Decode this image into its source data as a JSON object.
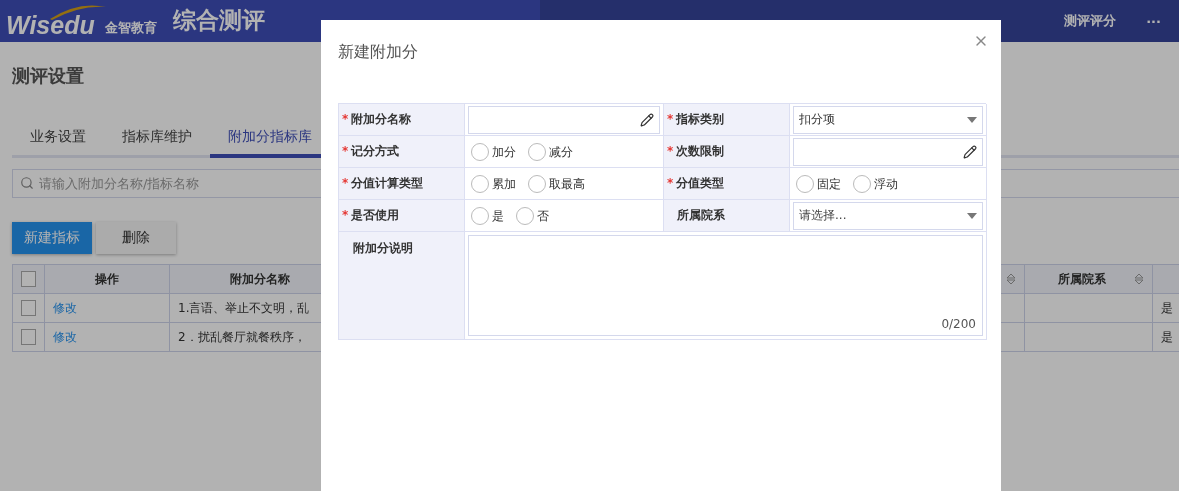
{
  "header": {
    "logo_text": "Wisedu",
    "logo_subtitle": "金智教育",
    "app_title": "综合测评",
    "nav": [
      {
        "label": "测评评分"
      }
    ],
    "more": "···"
  },
  "page": {
    "title": "测评设置",
    "tabs": [
      {
        "label": "业务设置",
        "selected": false
      },
      {
        "label": "指标库维护",
        "selected": false
      },
      {
        "label": "附加分指标库",
        "selected": true
      }
    ],
    "search": {
      "placeholder": "请输入附加分名称/指标名称"
    },
    "buttons": [
      {
        "label": "新建指标",
        "kind": "primary"
      },
      {
        "label": "删除",
        "kind": "default"
      }
    ],
    "table": {
      "columns": [
        {
          "label": "操作",
          "sortable": false
        },
        {
          "label": "附加分名称",
          "sortable": false
        },
        {
          "sortable": true
        },
        {
          "label": "所属院系",
          "sortable": true
        },
        {
          "sortable": false
        }
      ],
      "header_checked": false,
      "rows": [
        {
          "checked": false,
          "action": "修改",
          "name": "1.言语、举止不文明，乱",
          "column_5": "是"
        },
        {
          "checked": false,
          "action": "修改",
          "name": "2．扰乱餐厅就餐秩序，",
          "column_5": "是"
        }
      ]
    }
  },
  "dialog": {
    "title": "新建附加分",
    "required_mark": "*",
    "fields": [
      {
        "label": "附加分名称",
        "required": true,
        "kind": "text"
      },
      {
        "label": "指标类别",
        "required": true,
        "kind": "select",
        "value": "扣分项"
      },
      {
        "label": "记分方式",
        "required": true,
        "kind": "radio",
        "options": [
          {
            "label": "加分",
            "selected": false
          },
          {
            "label": "减分",
            "selected": false
          }
        ]
      },
      {
        "label": "次数限制",
        "required": true,
        "kind": "text"
      },
      {
        "label": "分值计算类型",
        "required": true,
        "kind": "radio",
        "options": [
          {
            "label": "累加",
            "selected": false
          },
          {
            "label": "取最高",
            "selected": false
          }
        ]
      },
      {
        "label": "分值类型",
        "required": true,
        "kind": "radio",
        "options": [
          {
            "label": "固定",
            "selected": false
          },
          {
            "label": "浮动",
            "selected": false
          }
        ]
      },
      {
        "label": "是否使用",
        "required": true,
        "kind": "radio",
        "options": [
          {
            "label": "是",
            "selected": false
          },
          {
            "label": "否",
            "selected": false
          }
        ]
      },
      {
        "label": "所属院系",
        "required": false,
        "kind": "select",
        "placeholder": "请选择..."
      },
      {
        "label": "附加分说明",
        "required": false,
        "kind": "textarea",
        "counter": "0/200"
      }
    ]
  }
}
